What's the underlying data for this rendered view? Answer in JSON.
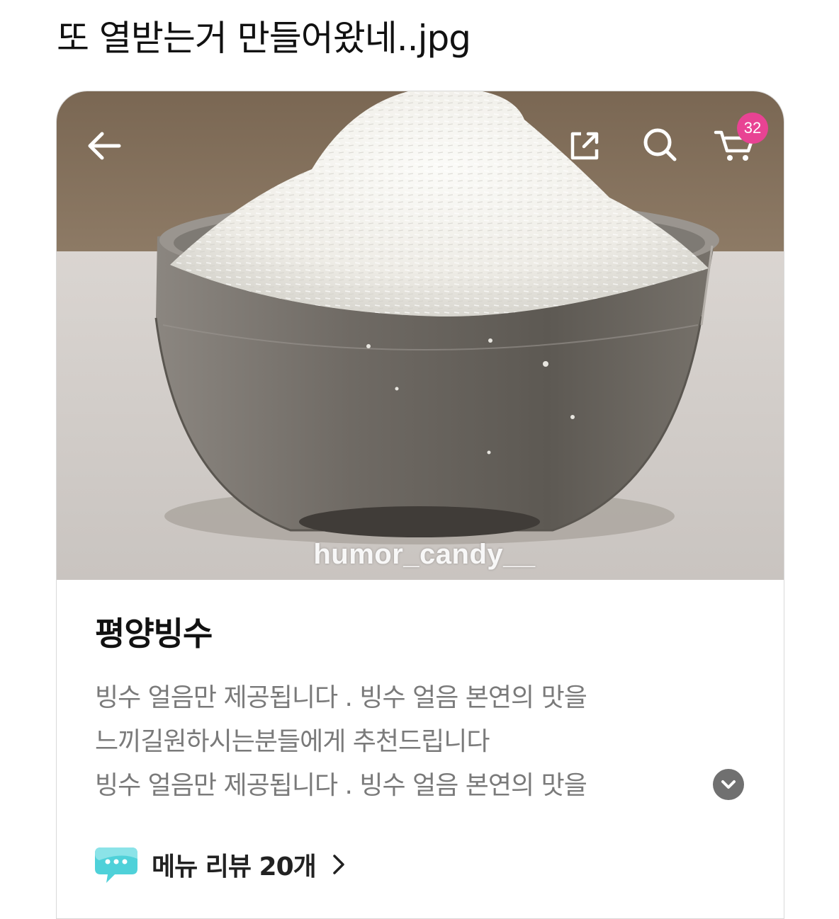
{
  "post": {
    "title": "또 열받는거 만들어왔네..jpg"
  },
  "topbar": {
    "back_icon": "arrow-left-icon",
    "share_icon": "share-icon",
    "search_icon": "search-icon",
    "cart_icon": "cart-icon",
    "cart_count": "32",
    "badge_color": "#e84393"
  },
  "photo": {
    "watermark": "humor_candy__"
  },
  "product": {
    "name": "평양빙수",
    "description_lines": [
      "빙수 얼음만 제공됩니다 . 빙수 얼음 본연의 맛을",
      "느끼길원하시는분들에게 추천드립니다",
      "빙수 얼음만 제공됩니다 . 빙수 얼음 본연의 맛을"
    ],
    "expand_icon": "chevron-down-icon"
  },
  "review": {
    "icon": "speech-bubble-icon",
    "label": "메뉴 리뷰 20개",
    "chevron_icon": "chevron-right-icon",
    "icon_color": "#4fd1d9"
  }
}
